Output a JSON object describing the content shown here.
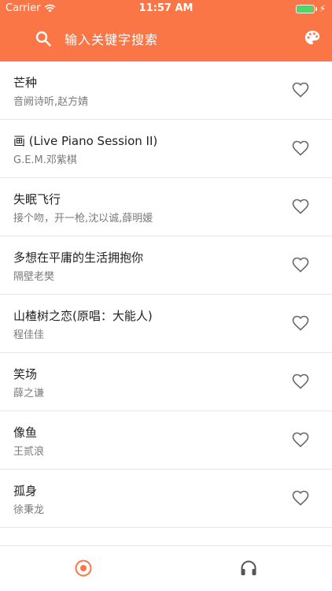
{
  "status_bar": {
    "carrier": "Carrier",
    "time": "11:57 AM",
    "battery_color": "#4cd964"
  },
  "header": {
    "background_color": "#fa7646",
    "search_placeholder": "输入关键字搜索",
    "search_icon": "search-icon",
    "theme_icon": "palette-icon"
  },
  "songs": [
    {
      "title": "芒种",
      "artist": "音阙诗听,赵方婧"
    },
    {
      "title": "画 (Live Piano Session II)",
      "artist": "G.E.M.邓紫棋"
    },
    {
      "title": "失眠飞行",
      "artist": "接个吻，开一枪,沈以诚,薛明媛"
    },
    {
      "title": "多想在平庸的生活拥抱你",
      "artist": "隔壁老樊"
    },
    {
      "title": "山楂树之恋(原唱：大能人)",
      "artist": "程佳佳"
    },
    {
      "title": "笑场",
      "artist": "薛之谦"
    },
    {
      "title": "像鱼",
      "artist": "王贰浪"
    },
    {
      "title": "孤身",
      "artist": "徐秉龙"
    }
  ],
  "tab_bar": {
    "tabs": [
      {
        "icon": "record-icon",
        "active": true
      },
      {
        "icon": "headphones-icon",
        "active": false
      }
    ],
    "active_color": "#fa7646",
    "inactive_color": "#555555"
  }
}
